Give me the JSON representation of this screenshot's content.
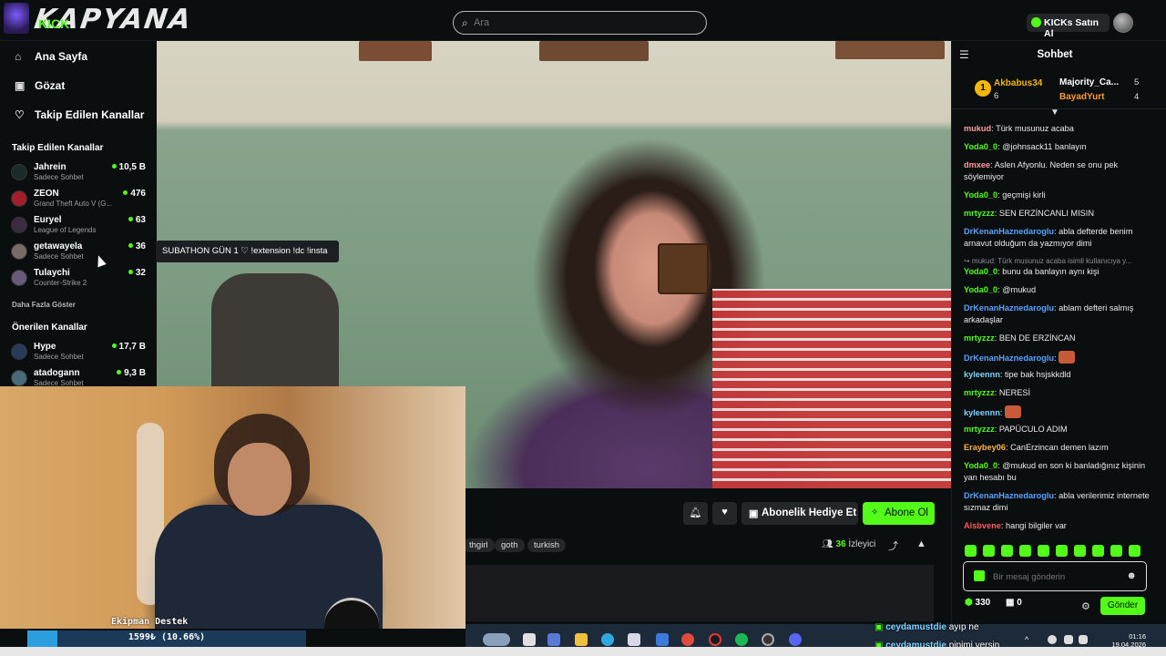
{
  "app": {
    "logo_text": "KAPYANA",
    "logo_sub": "KICK"
  },
  "search": {
    "placeholder": "Ara"
  },
  "header": {
    "kicks_label": "KICKs Satın Al"
  },
  "sidebar": {
    "nav": [
      {
        "label": "Ana Sayfa",
        "icon": "home-icon"
      },
      {
        "label": "Gözat",
        "icon": "browse-icon"
      },
      {
        "label": "Takip Edilen Kanallar",
        "icon": "heart-icon"
      }
    ],
    "followed_title": "Takip Edilen Kanallar",
    "followed": [
      {
        "name": "Jahrein",
        "category": "Sadece Sohbet",
        "viewers": "10,5 B"
      },
      {
        "name": "ZEON",
        "category": "Grand Theft Auto V (G...",
        "viewers": "476"
      },
      {
        "name": "Euryel",
        "category": "League of Legends",
        "viewers": "63"
      },
      {
        "name": "getawayela",
        "category": "Sadece Sohbet",
        "viewers": "36"
      },
      {
        "name": "Tulaychi",
        "category": "Counter-Strike 2",
        "viewers": "32"
      }
    ],
    "show_more": "Daha Fazla Göster",
    "recommended_title": "Önerilen Kanallar",
    "recommended": [
      {
        "name": "Hype",
        "category": "Sadece Sohbet",
        "viewers": "17,7 B"
      },
      {
        "name": "atadogann",
        "category": "Sadece Sohbet",
        "viewers": "9,3 B"
      }
    ]
  },
  "tooltip": {
    "text": "SUBATHON GÜN 1 ♡ !extension !dc !insta"
  },
  "stream": {
    "gift_label": "Abonelik Hediye Et",
    "subscribe_label": "Abone Ol",
    "tags": [
      "thgirl",
      "goth",
      "turkish"
    ],
    "viewer_count": "36",
    "viewer_label": "İzleyici"
  },
  "overlay": {
    "donate_label": "Ekipman Destek",
    "progress_text": "1599₺ (10.66%)",
    "progress_fraction": 0.1066
  },
  "stream_overlay_chat": [
    {
      "user": "ceydamustdie",
      "text": "ayıp he"
    },
    {
      "user": "ceydamustdie",
      "text": "pipimi yersin"
    }
  ],
  "taskbar": {
    "time": "01:16",
    "date": "19.04.2026"
  },
  "chat": {
    "title": "Sohbet",
    "leaderboard": [
      {
        "rank": "1",
        "name": "Akbabus34",
        "value": "6"
      },
      {
        "name": "Majority_Ca...",
        "value": "5"
      },
      {
        "name": "BayadYurt",
        "value": "4"
      }
    ],
    "messages": [
      {
        "user": "mukud",
        "color": "#ff9a9a",
        "text": "Türk musunuz acaba"
      },
      {
        "user": "Yoda0_0",
        "color": "#53fc18",
        "text": "@johnsack11 banlayın"
      },
      {
        "user": "dmxee",
        "color": "#ff9a9a",
        "text": "Aslen Afyonlu. Neden se onu pek söylemiyor"
      },
      {
        "user": "Yoda0_0",
        "color": "#53fc18",
        "text": "geçmişi kirli"
      },
      {
        "user": "mrtyzzz",
        "color": "#53fc18",
        "text": "SEN ERZİNCANLI MISIN"
      },
      {
        "user": "DrKenanHaznedaroglu",
        "color": "#5aa2ff",
        "text": "abla defterde benim arnavut olduğum da yazmıyor dimi"
      },
      {
        "user": "",
        "color": "#8a8f93",
        "text": "↪ mukud: Türk musunuz acaba isimli kullanıcıya y..."
      },
      {
        "user": "Yoda0_0",
        "color": "#53fc18",
        "text": "bunu da banlayın aynı kişi"
      },
      {
        "user": "Yoda0_0",
        "color": "#53fc18",
        "text": "@mukud"
      },
      {
        "user": "DrKenanHaznedaroglu",
        "color": "#5aa2ff",
        "text": "ablam defteri salmış arkadaşlar"
      },
      {
        "user": "mrtyzzz",
        "color": "#53fc18",
        "text": "BEN DE ERZİNCAN"
      },
      {
        "user": "DrKenanHaznedaroglu",
        "color": "#5aa2ff",
        "text": ""
      },
      {
        "user": "kyleennn",
        "color": "#7fd2ff",
        "text": "tipe bak hsjskkdld"
      },
      {
        "user": "mrtyzzz",
        "color": "#53fc18",
        "text": "NERESİ"
      },
      {
        "user": "kyleennn",
        "color": "#7fd2ff",
        "text": ""
      },
      {
        "user": "mrtyzzz",
        "color": "#53fc18",
        "text": "PAPÜCULO ADIM"
      },
      {
        "user": "Eraybey06",
        "color": "#ffb347",
        "text": "CanErzincan demen lazım"
      },
      {
        "user": "Yoda0_0",
        "color": "#53fc18",
        "text": "@mukud en son ki banladığınız kişinin yan hesabı bu"
      },
      {
        "user": "DrKenanHaznedaroglu",
        "color": "#5aa2ff",
        "text": "abla verilerimiz internete sızmaz dimi"
      },
      {
        "user": "Aisbvene",
        "color": "#ff5a5a",
        "text": "hangi bilgiler var"
      }
    ],
    "input_placeholder": "Bir mesaj gönderin",
    "points": "330",
    "gifts": "0",
    "send_label": "Gönder"
  },
  "colors": {
    "accent": "#53fc18",
    "background": "#0b0e0f",
    "panel": "#24272a"
  }
}
